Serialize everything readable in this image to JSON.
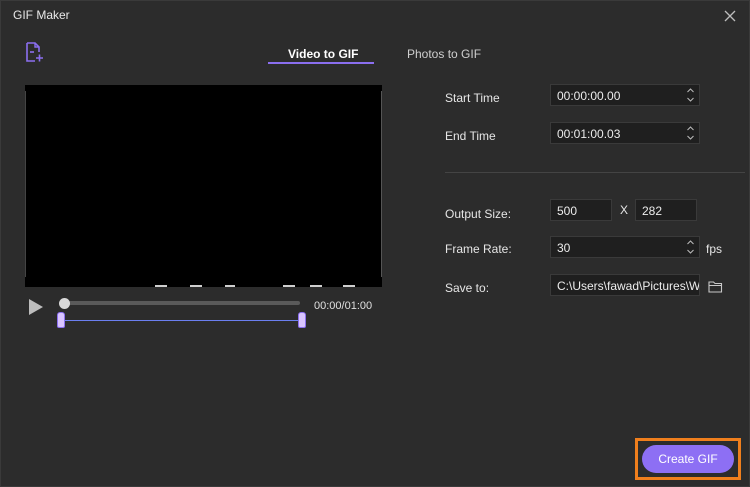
{
  "window": {
    "title": "GIF Maker"
  },
  "tabs": [
    {
      "label": "Video to GIF",
      "active": true
    },
    {
      "label": "Photos to GIF",
      "active": false
    }
  ],
  "player": {
    "time": "00:00/01:00"
  },
  "settings": {
    "start_time": {
      "label": "Start Time",
      "value": "00:00:00.00"
    },
    "end_time": {
      "label": "End Time",
      "value": "00:01:00.03"
    },
    "output_size": {
      "label": "Output Size:",
      "width": "500",
      "separator": "X",
      "height": "282"
    },
    "frame_rate": {
      "label": "Frame Rate:",
      "value": "30",
      "unit": "fps"
    },
    "save_to": {
      "label": "Save to:",
      "value": "C:\\Users\\fawad\\Pictures\\Wo"
    }
  },
  "actions": {
    "create_label": "Create GIF"
  },
  "colors": {
    "accent": "#8d6ff4",
    "highlight": "#f07f1d",
    "background": "#2c2c2c"
  },
  "icons": [
    "close-icon",
    "add-file-icon",
    "play-icon",
    "spin-icon",
    "folder-icon"
  ]
}
